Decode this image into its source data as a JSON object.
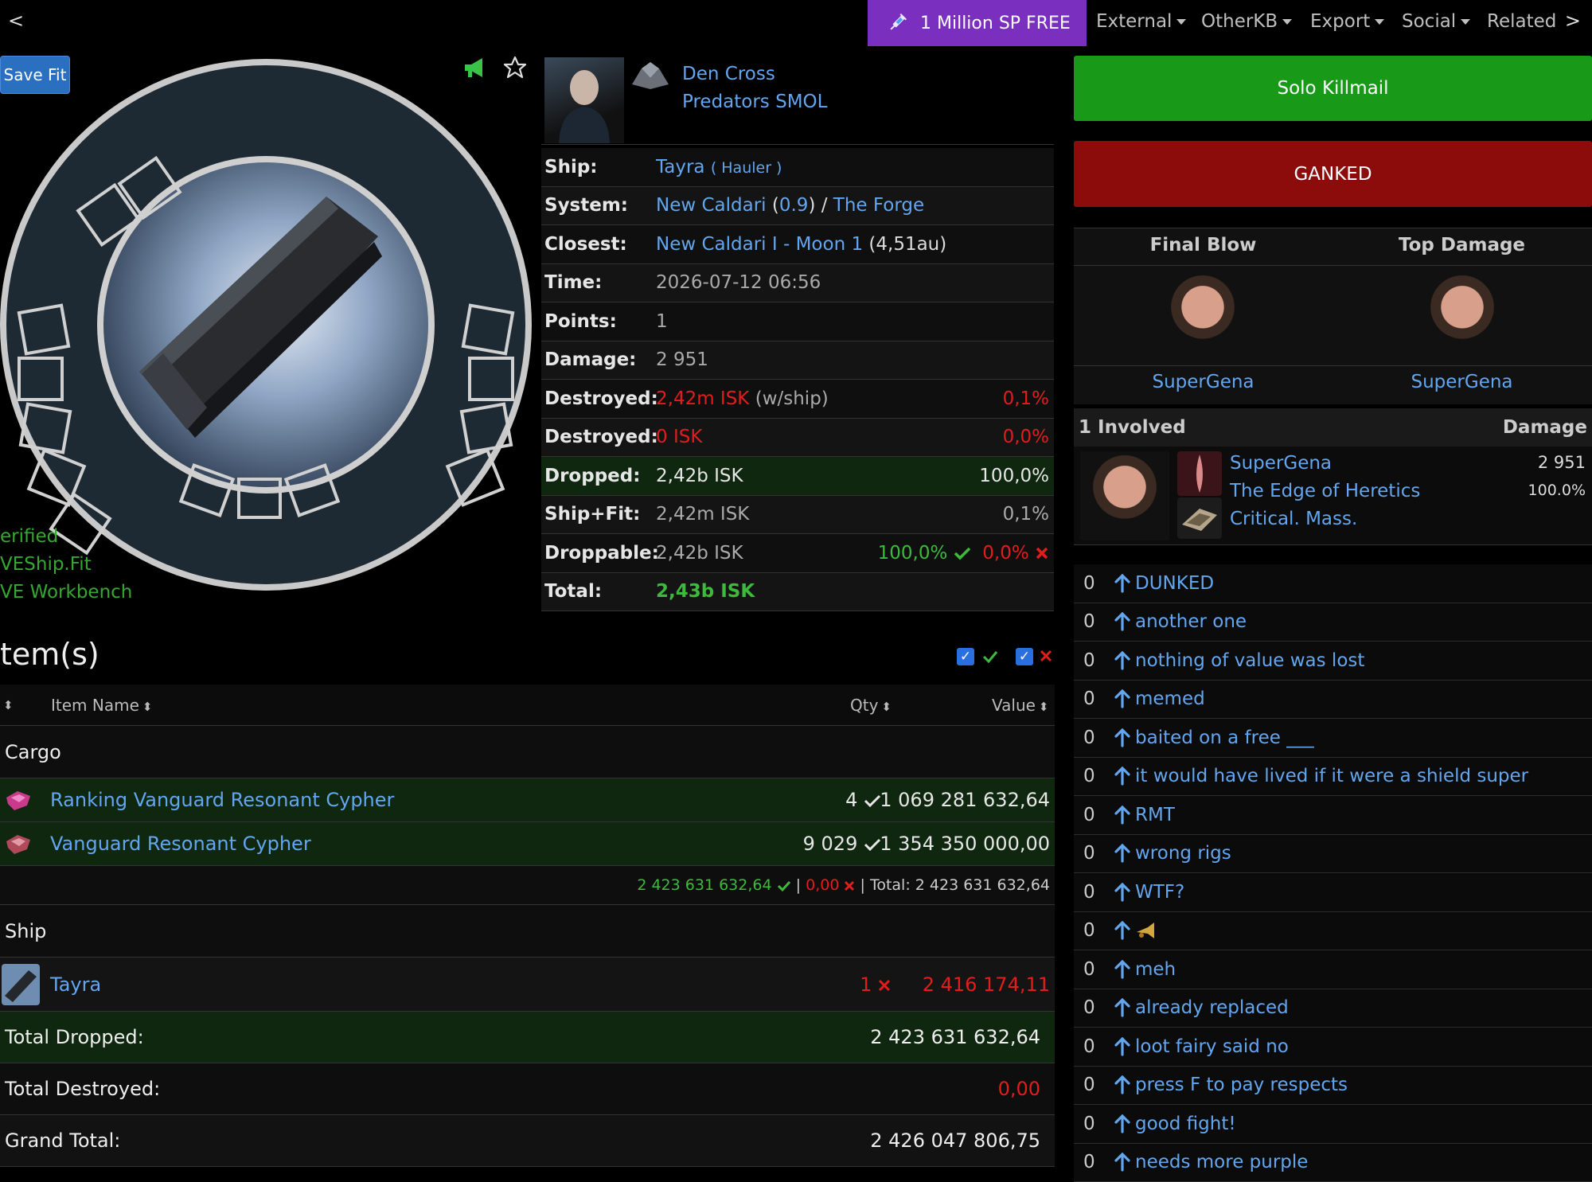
{
  "nav": {
    "back": "<",
    "forward": ">",
    "promo": "1 Million SP FREE",
    "items": [
      "External",
      "OtherKB",
      "Export",
      "Social",
      "Related"
    ]
  },
  "fit": {
    "save_label": "Save Fit",
    "links": [
      "erified",
      "VEShip.Fit",
      "VE Workbench"
    ]
  },
  "victim": {
    "pilot": "Den Cross",
    "corp": "Predators SMOL"
  },
  "info": {
    "ship_label": "Ship:",
    "ship_name": "Tayra",
    "ship_class": "( Hauler )",
    "system_label": "System:",
    "system_name": "New Caldari",
    "system_sec": "0.9",
    "region": "The Forge",
    "closest_label": "Closest:",
    "closest_name": "New Caldari I - Moon 1",
    "closest_dist": "(4,51au)",
    "time_label": "Time:",
    "time": "2026-07-12 06:56",
    "points_label": "Points:",
    "points": "1",
    "damage_label": "Damage:",
    "damage": "2 951",
    "destroyed_label": "Destroyed:",
    "destroyed_ship": "2,42m ISK",
    "destroyed_ship_note": "(w/ship)",
    "destroyed_ship_pct": "0,1%",
    "destroyed2_label": "Destroyed:",
    "destroyed_items": "0 ISK",
    "destroyed_items_pct": "0,0%",
    "dropped_label": "Dropped:",
    "dropped": "2,42b ISK",
    "dropped_pct": "100,0%",
    "shipfit_label": "Ship+Fit:",
    "shipfit": "2,42m ISK",
    "shipfit_pct": "0,1%",
    "droppable_label": "Droppable:",
    "droppable": "2,42b ISK",
    "droppable_yes": "100,0%",
    "droppable_no": "0,0%",
    "total_label": "Total:",
    "total": "2,43b ISK"
  },
  "items": {
    "title": "tem(s)",
    "col_name": "Item Name",
    "col_qty": "Qty",
    "col_value": "Value",
    "cargo_label": "Cargo",
    "cargo": [
      {
        "name": "Ranking Vanguard Resonant Cypher",
        "qty": "4",
        "value": "1 069 281 632,64"
      },
      {
        "name": "Vanguard Resonant Cypher",
        "qty": "9 029",
        "value": "1 354 350 000,00"
      }
    ],
    "cargo_dropped": "2 423 631 632,64",
    "cargo_destroyed": "0,00",
    "cargo_total": "| Total: 2 423 631 632,64",
    "ship_label": "Ship",
    "ship_item": {
      "name": "Tayra",
      "qty": "1",
      "value": "2 416 174,11"
    },
    "total_dropped_label": "Total Dropped:",
    "total_dropped": "2 423 631 632,64",
    "total_destroyed_label": "Total Destroyed:",
    "total_destroyed": "0,00",
    "grand_total_label": "Grand Total:",
    "grand_total": "2 426 047 806,75"
  },
  "kill": {
    "solo": "Solo Killmail",
    "ganked": "GANKED",
    "final_blow_label": "Final Blow",
    "top_damage_label": "Top Damage",
    "final_blow_name": "SuperGena",
    "top_damage_name": "SuperGena",
    "involved_label": "1 Involved",
    "damage_label": "Damage",
    "attacker": {
      "name": "SuperGena",
      "corp": "The Edge of Heretics",
      "alliance": "Critical. Mass.",
      "damage": "2 951",
      "pct": "100.0%"
    }
  },
  "comments": [
    {
      "count": "0",
      "text": "DUNKED"
    },
    {
      "count": "0",
      "text": "another one"
    },
    {
      "count": "0",
      "text": "nothing of value was lost"
    },
    {
      "count": "0",
      "text": "memed"
    },
    {
      "count": "0",
      "text": "baited on a free ___"
    },
    {
      "count": "0",
      "text": "it would have lived if it were a shield super"
    },
    {
      "count": "0",
      "text": "RMT"
    },
    {
      "count": "0",
      "text": "wrong rigs"
    },
    {
      "count": "0",
      "text": "WTF?"
    },
    {
      "count": "0",
      "text": ""
    },
    {
      "count": "0",
      "text": "meh"
    },
    {
      "count": "0",
      "text": "already replaced"
    },
    {
      "count": "0",
      "text": "loot fairy said no"
    },
    {
      "count": "0",
      "text": "press F to pay respects"
    },
    {
      "count": "0",
      "text": "good fight!"
    },
    {
      "count": "0",
      "text": "needs more purple"
    }
  ],
  "colors": {
    "promo": "#7b2fbe",
    "solo": "#189a18",
    "ganked": "#8c0c0c",
    "link": "#63a6f0",
    "red": "#e31c1c",
    "green": "#3dba3d"
  }
}
